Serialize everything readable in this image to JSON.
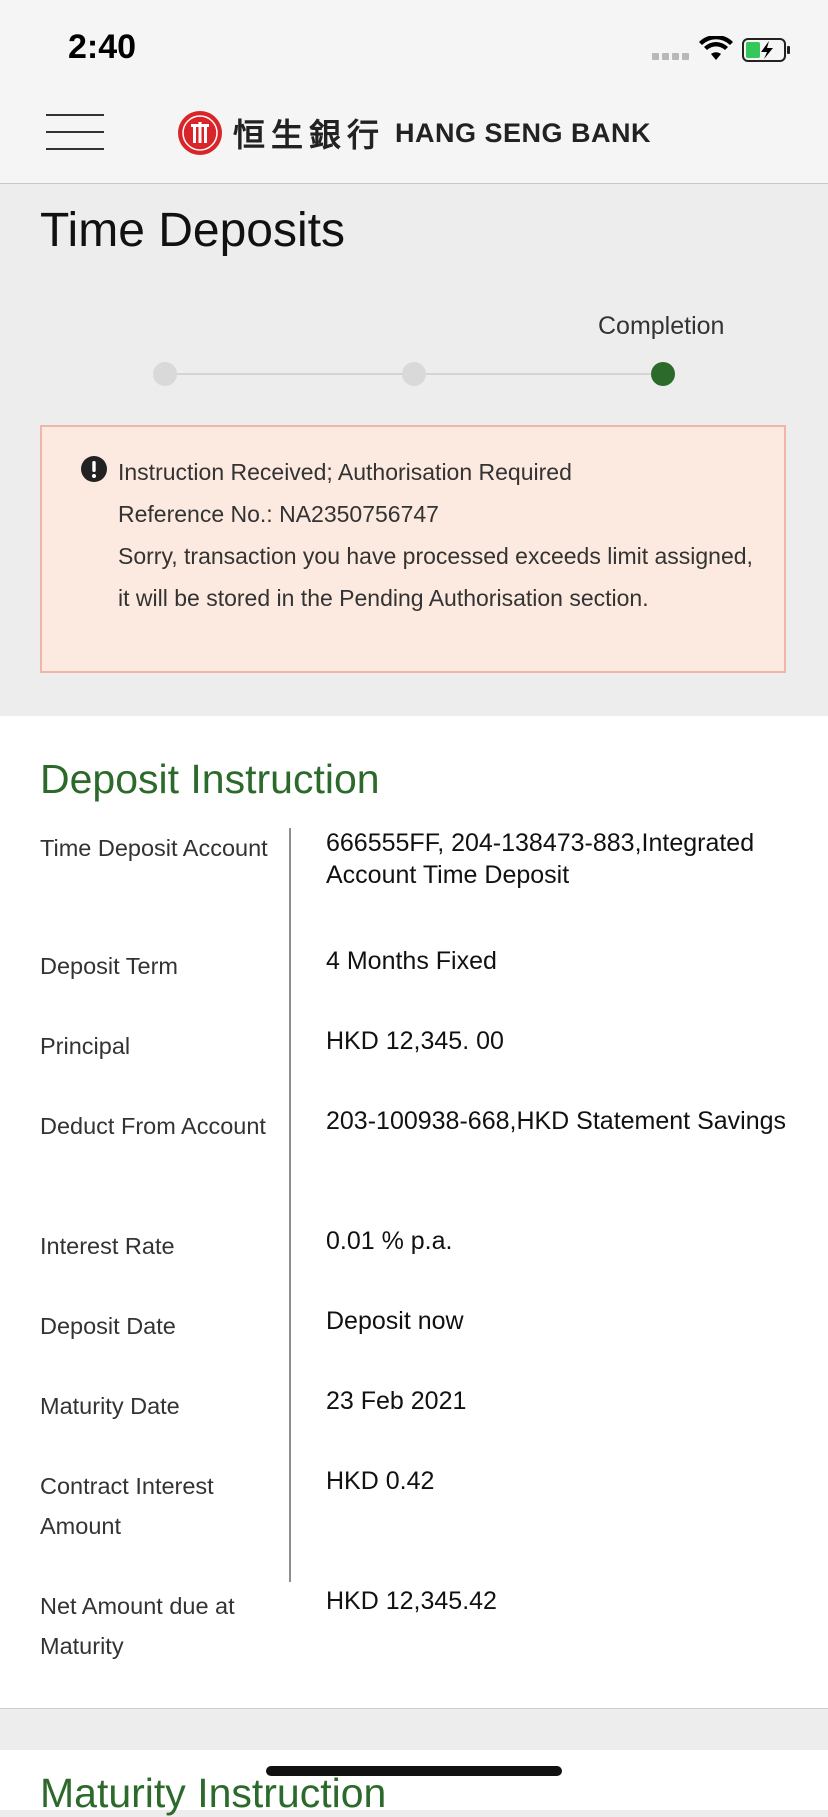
{
  "status_bar": {
    "time": "2:40"
  },
  "header": {
    "logo_cn": "恒生銀行",
    "logo_en": "HANG SENG BANK"
  },
  "page": {
    "title": "Time Deposits"
  },
  "progress": {
    "current_step_label": "Completion",
    "steps_total": 3,
    "current_step": 3
  },
  "alert": {
    "line1": "Instruction Received; Authorisation Required",
    "line2": "Reference No.: NA2350756747",
    "message": "Sorry, transaction you have processed exceeds limit assigned, it will be stored in the Pending Authorisation section."
  },
  "deposit_instruction": {
    "title": "Deposit Instruction",
    "rows": [
      {
        "label": "Time Deposit Account",
        "value": "666555FF, 204-138473-883,Integrated Account Time Deposit"
      },
      {
        "label": "Deposit Term",
        "value": "4 Months Fixed"
      },
      {
        "label": "Principal",
        "value": "HKD 12,345. 00"
      },
      {
        "label": "Deduct From Account",
        "value": "203-100938-668,HKD Statement Savings"
      },
      {
        "label": "Interest Rate",
        "value": "0.01 % p.a."
      },
      {
        "label": "Deposit Date",
        "value": "Deposit now"
      },
      {
        "label": "Maturity Date",
        "value": "23 Feb 2021"
      },
      {
        "label": "Contract Interest Amount",
        "value": "HKD 0.42"
      },
      {
        "label": "Net Amount due at Maturity",
        "value": "HKD 12,345.42"
      }
    ]
  },
  "maturity_instruction": {
    "title": "Maturity Instruction"
  },
  "colors": {
    "accent_green": "#2c6a2c",
    "alert_bg": "#fce9df",
    "alert_border": "#f0b7a8",
    "brand_red": "#d9252a"
  },
  "icons": {
    "menu": "hamburger-icon",
    "alert": "exclamation-circle-icon",
    "logo": "hang-seng-emblem-icon"
  }
}
